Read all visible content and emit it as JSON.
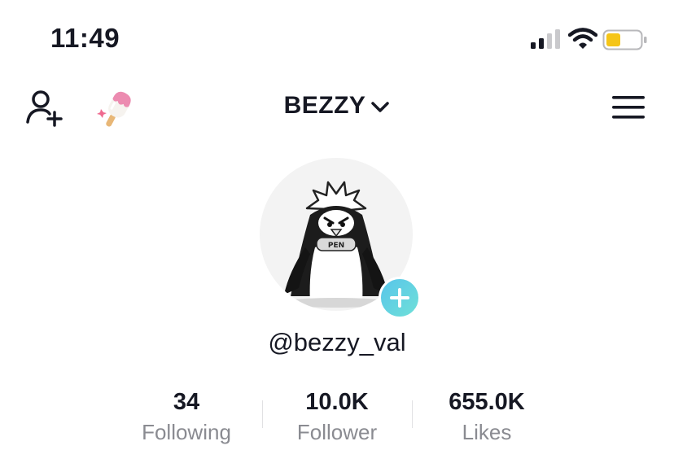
{
  "status_bar": {
    "time": "11:49",
    "battery_color": "#f5c518"
  },
  "header": {
    "username": "BEZZY",
    "add_user_icon": "person-plus-icon",
    "popsicle_icon": "popsicle-icon",
    "menu_icon": "hamburger-icon"
  },
  "profile": {
    "handle": "@bezzy_val",
    "avatar_badge_text": "PEN"
  },
  "stats": [
    {
      "value": "34",
      "label": "Following"
    },
    {
      "value": "10.0K",
      "label": "Follower"
    },
    {
      "value": "655.0K",
      "label": "Likes"
    }
  ]
}
